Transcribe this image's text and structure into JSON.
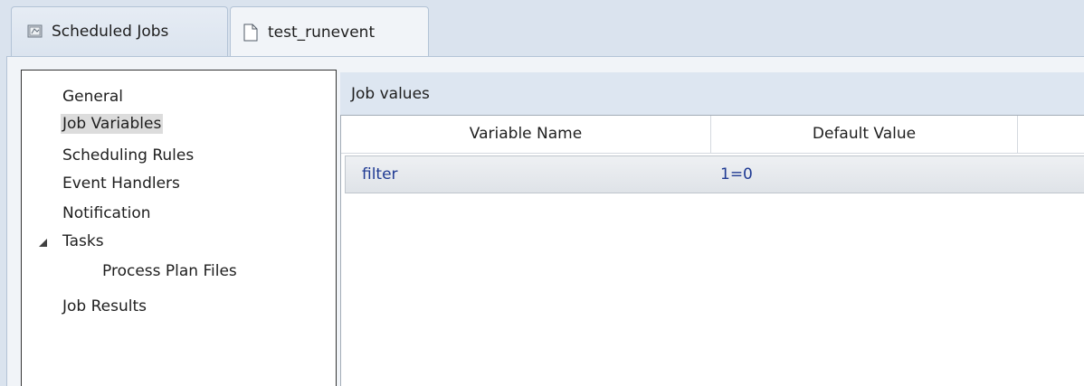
{
  "tabs": [
    {
      "label": "Scheduled Jobs",
      "icon": "scheduled-jobs-icon"
    },
    {
      "label": "test_runevent",
      "icon": "document-icon"
    }
  ],
  "nav": {
    "items": [
      {
        "label": "General"
      },
      {
        "label": "Job Variables",
        "selected": true
      },
      {
        "label": "Scheduling Rules"
      },
      {
        "label": "Event Handlers"
      },
      {
        "label": "Notification"
      },
      {
        "label": "Tasks",
        "expanded": true,
        "children": [
          {
            "label": "Process Plan Files"
          }
        ]
      },
      {
        "label": "Job Results"
      }
    ]
  },
  "section": {
    "title": "Job values",
    "columns": [
      "Variable Name",
      "Default Value"
    ],
    "rows": [
      {
        "name": "filter",
        "value": "1=0"
      }
    ]
  }
}
